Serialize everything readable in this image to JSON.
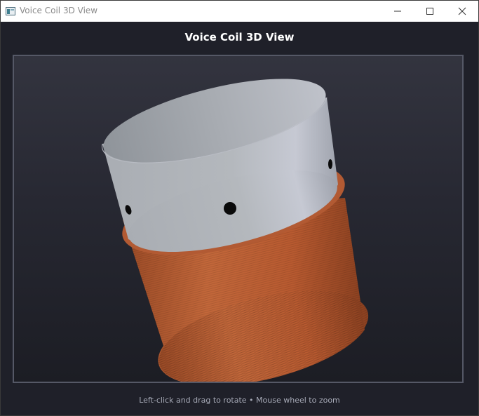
{
  "window": {
    "title": "Voice Coil 3D View"
  },
  "view": {
    "heading": "Voice Coil 3D View",
    "hint": "Left-click and drag to rotate  •  Mouse wheel to zoom"
  },
  "icons": {
    "app": "window-app-icon",
    "minimize": "minimize-icon",
    "maximize": "maximize-icon",
    "close": "close-icon"
  },
  "colors": {
    "coil_winding": "#b85a30",
    "former_cylinder": "#b4b8bc",
    "vent_holes": "#0a0a0a",
    "background_top": "#33343f",
    "background_bottom": "#1c1d24"
  }
}
